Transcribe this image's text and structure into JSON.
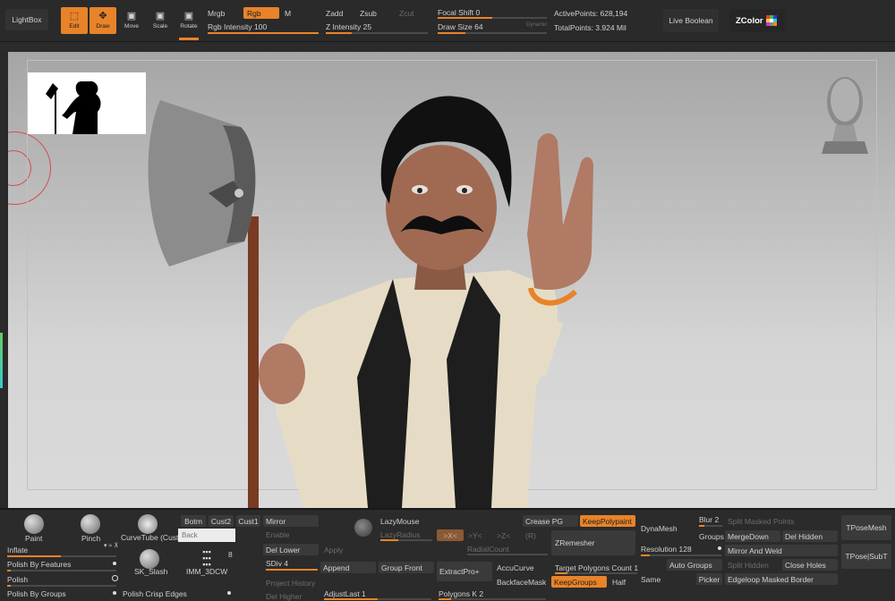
{
  "toolbar": {
    "lightbox": "LightBox",
    "edit": "Edit",
    "draw": "Draw",
    "move": "Move",
    "scale": "Scale",
    "rotate": "Rotate",
    "mrgb": "Mrgb",
    "rgb": "Rgb",
    "m": "M",
    "rgb_intensity_label": "Rgb Intensity",
    "rgb_intensity_value": "100",
    "zadd": "Zadd",
    "zsub": "Zsub",
    "zcut": "Zcut",
    "z_intensity_label": "Z Intensity",
    "z_intensity_value": "25",
    "focal_shift_label": "Focal Shift",
    "focal_shift_value": "0",
    "draw_size_label": "Draw Size",
    "draw_size_value": "64",
    "dynamic": "Dynamic",
    "active_points": "ActivePoints: 628,194",
    "total_points": "TotalPoints: 3.924 Mil",
    "live_boolean": "Live Boolean",
    "zcolor": "ZColor"
  },
  "levels": {
    "rgb_intensity": 1.0,
    "z_intensity": 0.25,
    "focal_shift": 0.5,
    "draw_size": 0.25
  },
  "brushes": {
    "paint": "Paint",
    "pinch": "Pinch",
    "curvetube": "CurveTube (Cust",
    "sk_slash": "SK_Slash",
    "imm_3dcw": "IMM_3DCW",
    "imm_count": "8",
    "inflate": "Inflate",
    "polish_by_features": "Polish By Features",
    "polish": "Polish",
    "polish_by_groups": "Polish By Groups",
    "polish_crisp_edges": "Polish Crisp Edges",
    "botm": "Botm",
    "cust2": "Cust2",
    "cust1": "Cust1",
    "search_placeholder": "Back"
  },
  "geometry": {
    "mirror": "Mirror",
    "enable": "Enable",
    "del_lower": "Del Lower",
    "apply": "Apply",
    "sdiv": "SDiv 4",
    "append": "Append",
    "group_front": "Group Front",
    "project_history": "Project History",
    "del_higher": "Del Higher",
    "adjust_last": "AdjustLast 1"
  },
  "stroke": {
    "lazymouse": "LazyMouse",
    "lazyradius": "LazyRadius",
    "x": ">X<",
    "y": ">Y<",
    "z": ">Z<",
    "r": "(R)",
    "radial_count": "RadialCount",
    "extract": "ExtractPro+",
    "accucurve": "AccuCurve",
    "backface_mask": "BackfaceMask",
    "polygons": "Polygons K 2"
  },
  "zremesh": {
    "crease_pg": "Crease PG",
    "keep_polypaint": "KeepPolypaint",
    "zremesher": "ZRemesher",
    "target_polygons": "Target Polygons Count 1",
    "keep_groups": "KeepGroups",
    "half": "Half",
    "same": "Same"
  },
  "dynamesh": {
    "dynamesh": "DynaMesh",
    "resolution": "Resolution 128",
    "blur": "Blur 2",
    "groups": "Groups",
    "auto_groups": "Auto Groups",
    "picker": "Picker"
  },
  "subtool": {
    "split_masked_points": "Split Masked Points",
    "merge_down": "MergeDown",
    "del_hidden": "Del Hidden",
    "mirror_and_weld": "Mirror And Weld",
    "split_hidden": "Split Hidden",
    "close_holes": "Close Holes",
    "edgeloop_masked_border": "Edgeloop Masked Border",
    "tpose_mesh": "TPoseMesh",
    "tpose_subt": "TPose|SubT"
  },
  "colors": {
    "accent": "#e8832a",
    "panel": "#2b2b2b",
    "button": "#3a3a3a",
    "viewport_top": "#a5a5a5",
    "viewport_bottom": "#dadada"
  }
}
